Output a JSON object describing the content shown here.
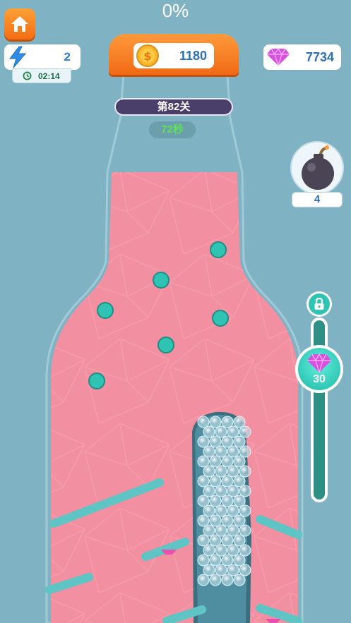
{
  "hud": {
    "progress": "0%",
    "energy_count": "2",
    "timer": "02:14",
    "coins": "1180",
    "gems": "7734",
    "level_label": "第82关",
    "time_left": "72秒"
  },
  "powerups": {
    "bomb_count": "4"
  },
  "reward": {
    "gem_reward_count": "30",
    "progress_fraction": 0
  },
  "icons": {
    "home": "home-icon",
    "energy": "lightning-icon",
    "timer": "clock-icon",
    "coin": "dollar-coin-icon",
    "gem": "diamond-icon",
    "bomb": "bomb-icon",
    "lock": "lock-icon"
  },
  "colors": {
    "background": "#7fb2c3",
    "liquid": "#f28fa0",
    "peg": "#2fc3b4",
    "accent_orange": "#f26d13",
    "level_banner": "#4a3f6b",
    "rail": "#2e8f85"
  }
}
